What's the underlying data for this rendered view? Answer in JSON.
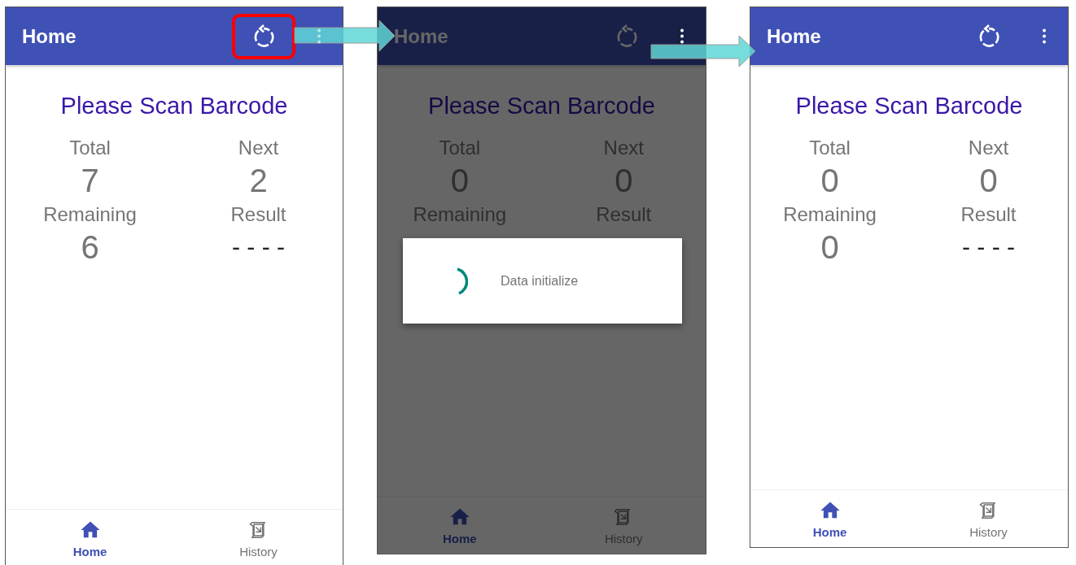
{
  "screens": [
    {
      "app_bar": {
        "title": "Home",
        "refresh_highlighted": true
      },
      "prompt": "Please Scan Barcode",
      "stats": [
        {
          "label": "Total",
          "value": "7"
        },
        {
          "label": "Next",
          "value": "2"
        },
        {
          "label": "Remaining",
          "value": "6"
        },
        {
          "label": "Result",
          "value": "- - - -"
        }
      ],
      "nav": [
        {
          "label": "Home",
          "selected": true
        },
        {
          "label": "History",
          "selected": false
        }
      ]
    },
    {
      "app_bar": {
        "title": "Home",
        "refresh_highlighted": false
      },
      "prompt": "Please Scan Barcode",
      "stats": [
        {
          "label": "Total",
          "value": "0"
        },
        {
          "label": "Next",
          "value": "0"
        },
        {
          "label": "Remaining"
        },
        {
          "label": "Result"
        }
      ],
      "nav": [
        {
          "label": "Home",
          "selected": true
        },
        {
          "label": "History",
          "selected": false
        }
      ],
      "dialog": {
        "message": "Data initialize"
      }
    },
    {
      "app_bar": {
        "title": "Home",
        "refresh_highlighted": false
      },
      "prompt": "Please Scan Barcode",
      "stats": [
        {
          "label": "Total",
          "value": "0"
        },
        {
          "label": "Next",
          "value": "0"
        },
        {
          "label": "Remaining",
          "value": "0"
        },
        {
          "label": "Result",
          "value": "- - - -"
        }
      ],
      "nav": [
        {
          "label": "Home",
          "selected": true
        },
        {
          "label": "History",
          "selected": false
        }
      ]
    }
  ]
}
